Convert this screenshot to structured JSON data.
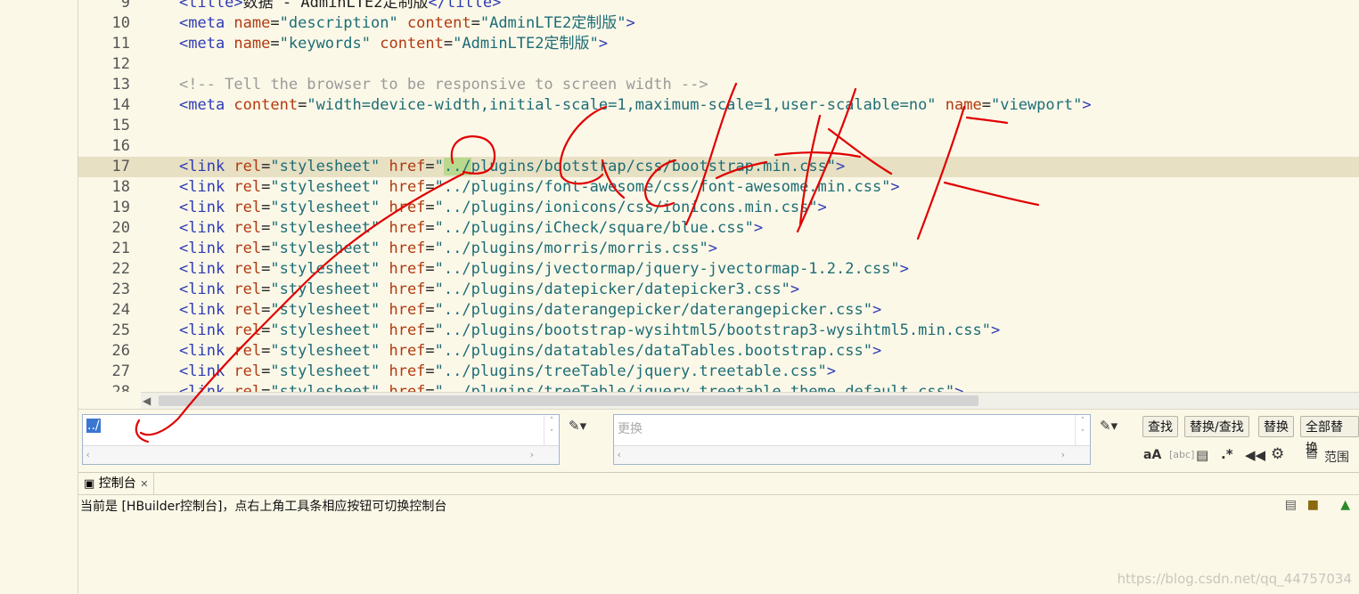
{
  "editor": {
    "lines": [
      {
        "num": "9",
        "current": false,
        "parts": [
          {
            "c": "tag",
            "t": "<title>"
          },
          {
            "c": "",
            "t": "数据 - AdminLTE2定制版"
          },
          {
            "c": "tag",
            "t": "</title>"
          }
        ]
      },
      {
        "num": "10",
        "current": false,
        "parts": [
          {
            "c": "tag",
            "t": "<meta "
          },
          {
            "c": "attr",
            "t": "name"
          },
          {
            "c": "",
            "t": "="
          },
          {
            "c": "str",
            "t": "\"description\""
          },
          {
            "c": "",
            "t": " "
          },
          {
            "c": "attr",
            "t": "content"
          },
          {
            "c": "",
            "t": "="
          },
          {
            "c": "str",
            "t": "\"AdminLTE2定制版\""
          },
          {
            "c": "tag",
            "t": ">"
          }
        ]
      },
      {
        "num": "11",
        "current": false,
        "parts": [
          {
            "c": "tag",
            "t": "<meta "
          },
          {
            "c": "attr",
            "t": "name"
          },
          {
            "c": "",
            "t": "="
          },
          {
            "c": "str",
            "t": "\"keywords\""
          },
          {
            "c": "",
            "t": " "
          },
          {
            "c": "attr",
            "t": "content"
          },
          {
            "c": "",
            "t": "="
          },
          {
            "c": "str",
            "t": "\"AdminLTE2定制版\""
          },
          {
            "c": "tag",
            "t": ">"
          }
        ]
      },
      {
        "num": "12",
        "current": false,
        "parts": []
      },
      {
        "num": "13",
        "current": false,
        "parts": [
          {
            "c": "comment",
            "t": "<!-- Tell the browser to be responsive to screen width -->"
          }
        ]
      },
      {
        "num": "14",
        "current": false,
        "parts": [
          {
            "c": "tag",
            "t": "<meta "
          },
          {
            "c": "attr",
            "t": "content"
          },
          {
            "c": "",
            "t": "="
          },
          {
            "c": "str",
            "t": "\"width=device-width,initial-scale=1,maximum-scale=1,user-scalable=no\""
          },
          {
            "c": "",
            "t": " "
          },
          {
            "c": "attr",
            "t": "name"
          },
          {
            "c": "",
            "t": "="
          },
          {
            "c": "str",
            "t": "\"viewport\""
          },
          {
            "c": "tag",
            "t": ">"
          }
        ]
      },
      {
        "num": "15",
        "current": false,
        "parts": []
      },
      {
        "num": "16",
        "current": false,
        "parts": []
      },
      {
        "num": "17",
        "current": true,
        "parts": [
          {
            "c": "tag",
            "t": "<link "
          },
          {
            "c": "attr",
            "t": "rel"
          },
          {
            "c": "",
            "t": "="
          },
          {
            "c": "str",
            "t": "\"stylesheet\""
          },
          {
            "c": "",
            "t": " "
          },
          {
            "c": "attr",
            "t": "href"
          },
          {
            "c": "",
            "t": "="
          },
          {
            "c": "str",
            "t": "\""
          },
          {
            "c": "str match",
            "t": "../"
          },
          {
            "c": "str",
            "t": "plugins/bootstrap/css/bootstrap.min.css\""
          },
          {
            "c": "tag",
            "t": ">"
          }
        ]
      },
      {
        "num": "18",
        "current": false,
        "parts": [
          {
            "c": "tag",
            "t": "<link "
          },
          {
            "c": "attr",
            "t": "rel"
          },
          {
            "c": "",
            "t": "="
          },
          {
            "c": "str",
            "t": "\"stylesheet\""
          },
          {
            "c": "",
            "t": " "
          },
          {
            "c": "attr",
            "t": "href"
          },
          {
            "c": "",
            "t": "="
          },
          {
            "c": "str",
            "t": "\"../plugins/font-awesome/css/font-awesome.min.css\""
          },
          {
            "c": "tag",
            "t": ">"
          }
        ]
      },
      {
        "num": "19",
        "current": false,
        "parts": [
          {
            "c": "tag",
            "t": "<link "
          },
          {
            "c": "attr",
            "t": "rel"
          },
          {
            "c": "",
            "t": "="
          },
          {
            "c": "str",
            "t": "\"stylesheet\""
          },
          {
            "c": "",
            "t": " "
          },
          {
            "c": "attr",
            "t": "href"
          },
          {
            "c": "",
            "t": "="
          },
          {
            "c": "str",
            "t": "\"../plugins/ionicons/css/ionicons.min.css\""
          },
          {
            "c": "tag",
            "t": ">"
          }
        ]
      },
      {
        "num": "20",
        "current": false,
        "parts": [
          {
            "c": "tag",
            "t": "<link "
          },
          {
            "c": "attr",
            "t": "rel"
          },
          {
            "c": "",
            "t": "="
          },
          {
            "c": "str",
            "t": "\"stylesheet\""
          },
          {
            "c": "",
            "t": " "
          },
          {
            "c": "attr",
            "t": "href"
          },
          {
            "c": "",
            "t": "="
          },
          {
            "c": "str",
            "t": "\"../plugins/iCheck/square/blue.css\""
          },
          {
            "c": "tag",
            "t": ">"
          }
        ]
      },
      {
        "num": "21",
        "current": false,
        "parts": [
          {
            "c": "tag",
            "t": "<link "
          },
          {
            "c": "attr",
            "t": "rel"
          },
          {
            "c": "",
            "t": "="
          },
          {
            "c": "str",
            "t": "\"stylesheet\""
          },
          {
            "c": "",
            "t": " "
          },
          {
            "c": "attr",
            "t": "href"
          },
          {
            "c": "",
            "t": "="
          },
          {
            "c": "str",
            "t": "\"../plugins/morris/morris.css\""
          },
          {
            "c": "tag",
            "t": ">"
          }
        ]
      },
      {
        "num": "22",
        "current": false,
        "parts": [
          {
            "c": "tag",
            "t": "<link "
          },
          {
            "c": "attr",
            "t": "rel"
          },
          {
            "c": "",
            "t": "="
          },
          {
            "c": "str",
            "t": "\"stylesheet\""
          },
          {
            "c": "",
            "t": " "
          },
          {
            "c": "attr",
            "t": "href"
          },
          {
            "c": "",
            "t": "="
          },
          {
            "c": "str",
            "t": "\"../plugins/jvectormap/jquery-jvectormap-1.2.2.css\""
          },
          {
            "c": "tag",
            "t": ">"
          }
        ]
      },
      {
        "num": "23",
        "current": false,
        "parts": [
          {
            "c": "tag",
            "t": "<link "
          },
          {
            "c": "attr",
            "t": "rel"
          },
          {
            "c": "",
            "t": "="
          },
          {
            "c": "str",
            "t": "\"stylesheet\""
          },
          {
            "c": "",
            "t": " "
          },
          {
            "c": "attr",
            "t": "href"
          },
          {
            "c": "",
            "t": "="
          },
          {
            "c": "str",
            "t": "\"../plugins/datepicker/datepicker3.css\""
          },
          {
            "c": "tag",
            "t": ">"
          }
        ]
      },
      {
        "num": "24",
        "current": false,
        "parts": [
          {
            "c": "tag",
            "t": "<link "
          },
          {
            "c": "attr",
            "t": "rel"
          },
          {
            "c": "",
            "t": "="
          },
          {
            "c": "str",
            "t": "\"stylesheet\""
          },
          {
            "c": "",
            "t": " "
          },
          {
            "c": "attr",
            "t": "href"
          },
          {
            "c": "",
            "t": "="
          },
          {
            "c": "str",
            "t": "\"../plugins/daterangepicker/daterangepicker.css\""
          },
          {
            "c": "tag",
            "t": ">"
          }
        ]
      },
      {
        "num": "25",
        "current": false,
        "parts": [
          {
            "c": "tag",
            "t": "<link "
          },
          {
            "c": "attr",
            "t": "rel"
          },
          {
            "c": "",
            "t": "="
          },
          {
            "c": "str",
            "t": "\"stylesheet\""
          },
          {
            "c": "",
            "t": " "
          },
          {
            "c": "attr",
            "t": "href"
          },
          {
            "c": "",
            "t": "="
          },
          {
            "c": "str",
            "t": "\"../plugins/bootstrap-wysihtml5/bootstrap3-wysihtml5.min.css\""
          },
          {
            "c": "tag",
            "t": ">"
          }
        ]
      },
      {
        "num": "26",
        "current": false,
        "parts": [
          {
            "c": "tag",
            "t": "<link "
          },
          {
            "c": "attr",
            "t": "rel"
          },
          {
            "c": "",
            "t": "="
          },
          {
            "c": "str",
            "t": "\"stylesheet\""
          },
          {
            "c": "",
            "t": " "
          },
          {
            "c": "attr",
            "t": "href"
          },
          {
            "c": "",
            "t": "="
          },
          {
            "c": "str",
            "t": "\"../plugins/datatables/dataTables.bootstrap.css\""
          },
          {
            "c": "tag",
            "t": ">"
          }
        ]
      },
      {
        "num": "27",
        "current": false,
        "parts": [
          {
            "c": "tag",
            "t": "<link "
          },
          {
            "c": "attr",
            "t": "rel"
          },
          {
            "c": "",
            "t": "="
          },
          {
            "c": "str",
            "t": "\"stylesheet\""
          },
          {
            "c": "",
            "t": " "
          },
          {
            "c": "attr",
            "t": "href"
          },
          {
            "c": "",
            "t": "="
          },
          {
            "c": "str",
            "t": "\"../plugins/treeTable/jquery.treetable.css\""
          },
          {
            "c": "tag",
            "t": ">"
          }
        ]
      },
      {
        "num": "28",
        "current": false,
        "parts": [
          {
            "c": "tag",
            "t": "<link "
          },
          {
            "c": "attr",
            "t": "rel"
          },
          {
            "c": "",
            "t": "="
          },
          {
            "c": "str",
            "t": "\"stylesheet\""
          },
          {
            "c": "",
            "t": " "
          },
          {
            "c": "attr",
            "t": "href"
          },
          {
            "c": "",
            "t": "="
          },
          {
            "c": "str",
            "t": "\"../plugins/treeTable/jquery.treetable.theme.default.css\""
          },
          {
            "c": "tag",
            "t": ">"
          }
        ]
      }
    ]
  },
  "find": {
    "find_value": "../",
    "replace_placeholder": "更换",
    "buttons": {
      "find": "查找",
      "replace_find": "替换/查找",
      "replace": "替换",
      "replace_all": "全部替换"
    },
    "option_icons": [
      "match-case-icon",
      "whole-word-icon",
      "in-selection-icon",
      "regex-icon",
      "search-backward-icon",
      "settings-icon"
    ],
    "option_labels": {
      "match_case": "aA",
      "whole_word": "[abc]",
      "regex": ".*"
    },
    "scope_label": "范围"
  },
  "console": {
    "tab_label": "控制台",
    "message": "当前是 [HBuilder控制台]，点右上角工具条相应按钮可切换控制台"
  },
  "watermark": "https://blog.csdn.net/qq_44757034",
  "colors": {
    "background": "#fcf8e8",
    "current_line": "#e8e0c3",
    "tag": "#2d3bb5",
    "attribute": "#b03a10",
    "string": "#1d6d76",
    "comment": "#9a9a9a",
    "match_highlight": "#b9d98f",
    "ink_annotation": "#e00000"
  }
}
